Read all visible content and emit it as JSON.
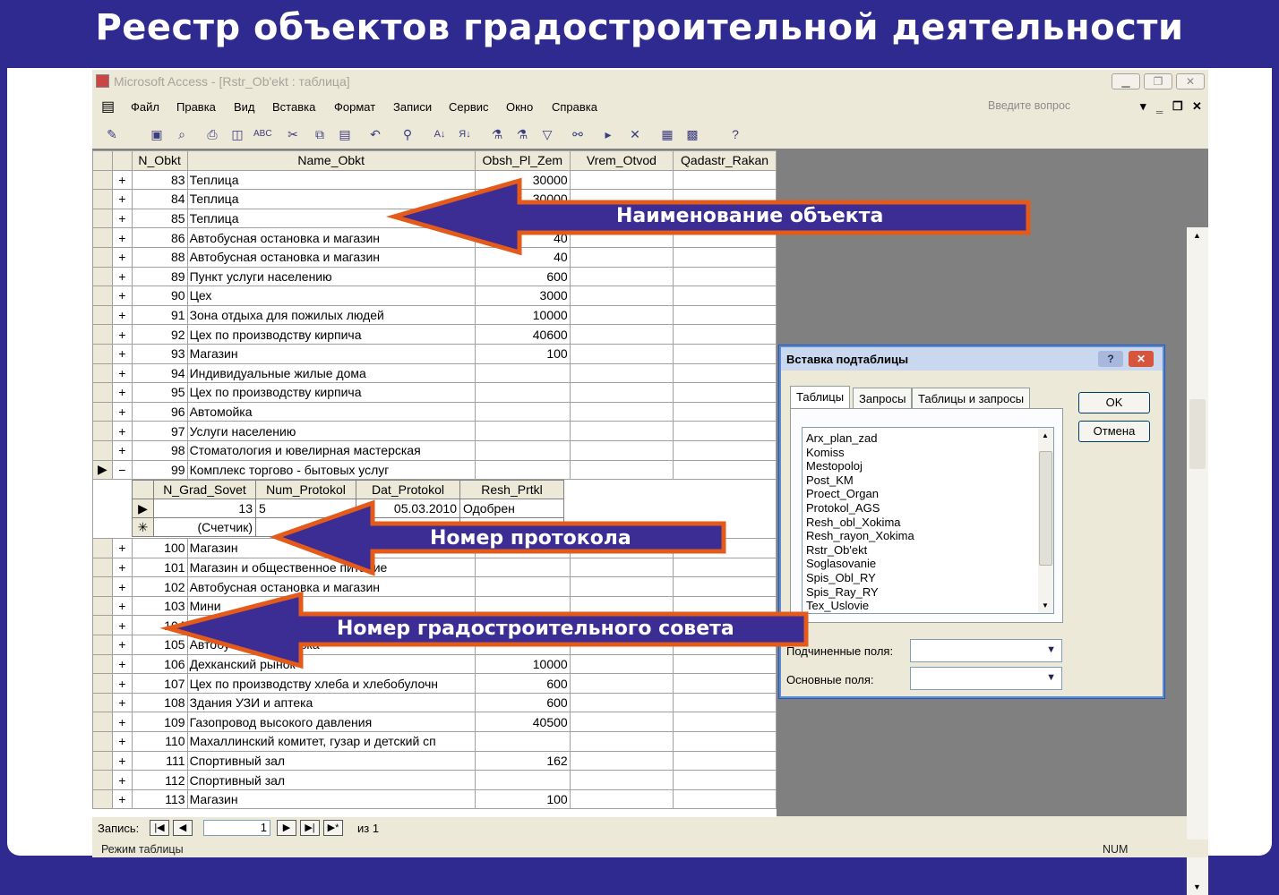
{
  "slide_title": "Реестр объектов градостроительной деятельности",
  "window": {
    "title": "Microsoft Access - [Rstr_Ob'ekt : таблица]",
    "menu": [
      "Файл",
      "Правка",
      "Вид",
      "Вставка",
      "Формат",
      "Записи",
      "Сервис",
      "Окно",
      "Справка"
    ],
    "ask_placeholder": "Введите вопрос"
  },
  "table": {
    "columns": [
      "N_Obkt",
      "Name_Obkt",
      "Obsh_Pl_Zem",
      "Vrem_Otvod",
      "Qadastr_Rakan"
    ],
    "rows": [
      {
        "n": "83",
        "name": "Теплица",
        "area": "30000"
      },
      {
        "n": "84",
        "name": "Теплица",
        "area": "30000"
      },
      {
        "n": "85",
        "name": "Теплица",
        "area": ""
      },
      {
        "n": "86",
        "name": "Автобусная остановка и магазин",
        "area": "40"
      },
      {
        "n": "88",
        "name": "Автобусная остановка и магазин",
        "area": "40"
      },
      {
        "n": "89",
        "name": "Пункт услуги населению",
        "area": "600"
      },
      {
        "n": "90",
        "name": "Цех",
        "area": "3000"
      },
      {
        "n": "91",
        "name": "Зона отдыха для пожилых людей",
        "area": "10000"
      },
      {
        "n": "92",
        "name": "Цех по производству кирпича",
        "area": "40600"
      },
      {
        "n": "93",
        "name": "Магазин",
        "area": "100"
      },
      {
        "n": "94",
        "name": "Индивидуальные жилые дома",
        "area": ""
      },
      {
        "n": "95",
        "name": "Цех по производству кирпича",
        "area": ""
      },
      {
        "n": "96",
        "name": "Автомойка",
        "area": ""
      },
      {
        "n": "97",
        "name": "Услуги населению",
        "area": ""
      },
      {
        "n": "98",
        "name": "Стоматология и ювелирная мастерская",
        "area": ""
      },
      {
        "n": "99",
        "name": "Комплекс торгово - бытовых услуг",
        "area": ""
      }
    ],
    "subtable": {
      "columns": [
        "N_Grad_Sovet",
        "Num_Protokol",
        "Dat_Protokol",
        "Resh_Prtkl"
      ],
      "row": [
        "13",
        "5",
        "05.03.2010",
        "Одобрен"
      ],
      "new_row": "(Счетчик)"
    },
    "rows_after": [
      {
        "n": "100",
        "name": "Магазин",
        "area": ""
      },
      {
        "n": "101",
        "name": "Магазин и общественное питание",
        "area": ""
      },
      {
        "n": "102",
        "name": "Автобусная остановка и магазин",
        "area": ""
      },
      {
        "n": "103",
        "name": "Мини",
        "area": ""
      },
      {
        "n": "104",
        "name": "",
        "area": ""
      },
      {
        "n": "105",
        "name": "Автобусная остановка",
        "area": ""
      },
      {
        "n": "106",
        "name": "Дехканский рынок",
        "area": "10000"
      },
      {
        "n": "107",
        "name": "Цех по производству хлеба и хлебобулочн",
        "area": "600"
      },
      {
        "n": "108",
        "name": "Здания УЗИ и аптека",
        "area": "600"
      },
      {
        "n": "109",
        "name": "Газопровод высокого давления",
        "area": "40500"
      },
      {
        "n": "110",
        "name": "Махаллинский комитет, гузар и детский сп",
        "area": ""
      },
      {
        "n": "111",
        "name": "Спортивный зал",
        "area": "162"
      },
      {
        "n": "112",
        "name": "Спортивный зал",
        "area": ""
      },
      {
        "n": "113",
        "name": "Магазин",
        "area": "100"
      }
    ]
  },
  "navigation": {
    "label": "Запись:",
    "record": "1",
    "of": "из 1"
  },
  "status": {
    "mode": "Режим таблицы",
    "num": "NUM"
  },
  "dialog": {
    "title": "Вставка подтаблицы",
    "tabs": [
      "Таблицы",
      "Запросы",
      "Таблицы и запросы"
    ],
    "list": [
      "Arx_plan_zad",
      "Komiss",
      "Mestopoloj",
      "Post_KM",
      "Proect_Organ",
      "Protokol_AGS",
      "Resh_obl_Xokima",
      "Resh_rayon_Xokima",
      "Rstr_Ob'ekt",
      "Soglasovanie",
      "Spis_Obl_RY",
      "Spis_Ray_RY",
      "Tex_Uslovie"
    ],
    "ok": "OK",
    "cancel": "Отмена",
    "child_fields_label": "Подчиненные поля:",
    "master_fields_label": "Основные поля:"
  },
  "annotations": {
    "name": "Наименование объекта",
    "protocol": "Номер протокола",
    "council": "Номер градостроительного совета"
  }
}
